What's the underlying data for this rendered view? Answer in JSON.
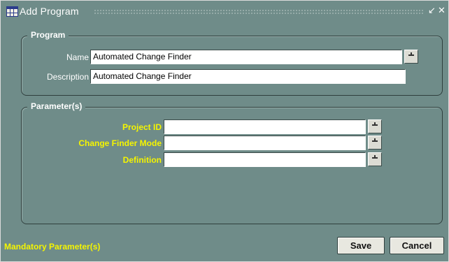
{
  "window": {
    "title": "Add Program",
    "icons": {
      "app": "table-grid-icon",
      "minimize": "minimize-arrow-icon",
      "close": "close-icon"
    }
  },
  "program": {
    "section_title": "Program",
    "name_label": "Name",
    "name_value": "Automated Change Finder",
    "description_label": "Description",
    "description_value": "Automated Change Finder"
  },
  "parameters": {
    "section_title": "Parameter(s)",
    "rows": [
      {
        "label": "Project ID",
        "value": ""
      },
      {
        "label": "Change Finder Mode",
        "value": ""
      },
      {
        "label": "Definition",
        "value": ""
      }
    ]
  },
  "footer": {
    "mandatory_note": "Mandatory Parameter(s)",
    "save_label": "Save",
    "cancel_label": "Cancel"
  },
  "colors": {
    "background": "#6f8c89",
    "mandatory_label": "#f5f500",
    "label": "#ffffff"
  }
}
